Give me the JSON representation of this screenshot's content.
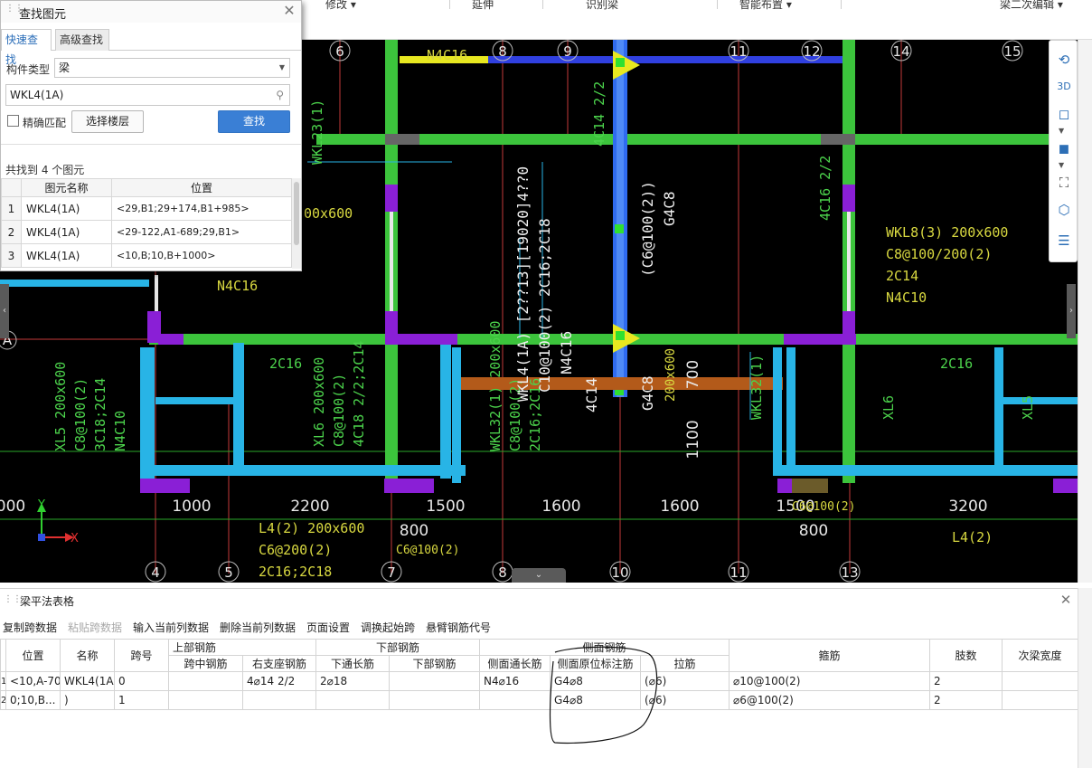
{
  "ribbon": {
    "items": [
      {
        "label": "修改",
        "has_caret": true
      },
      {
        "label": "延伸",
        "has_caret": false
      },
      {
        "label": "识别梁",
        "has_caret": false
      },
      {
        "label": "智能布置",
        "has_caret": true
      },
      {
        "label": "梁二次编辑",
        "has_caret": true
      }
    ]
  },
  "find_dialog": {
    "title": "查找图元",
    "tabs": [
      "快速查找",
      "高级查找"
    ],
    "type_label": "构件类型",
    "type_value": "梁",
    "search_value": "WKL4(1A)",
    "exact_match_label": "精确匹配",
    "select_floor_button": "选择楼层",
    "find_button": "查找",
    "result_count": "共找到 4 个图元",
    "columns": [
      "图元名称",
      "位置"
    ],
    "rows": [
      {
        "index": "1",
        "name": "WKL4(1A)",
        "location": "<29,B1;29+174,B1+985>"
      },
      {
        "index": "2",
        "name": "WKL4(1A)",
        "location": "<29-122,A1-689;29,B1>"
      },
      {
        "index": "3",
        "name": "WKL4(1A)",
        "location": "<10,B;10,B+1000>"
      }
    ]
  },
  "cad": {
    "top_axis_labels": [
      {
        "text": "6"
      },
      {
        "text": "8"
      },
      {
        "text": "9"
      },
      {
        "text": "11"
      },
      {
        "text": "12"
      },
      {
        "text": "14"
      },
      {
        "text": "15"
      }
    ],
    "bottom_axis_labels": [
      {
        "text": "4"
      },
      {
        "text": "5"
      },
      {
        "text": "7"
      },
      {
        "text": "8"
      },
      {
        "text": "10"
      },
      {
        "text": "11"
      },
      {
        "text": "13"
      }
    ],
    "left_axis_label": "A",
    "dimensions": [
      "000",
      "1000",
      "2200",
      "1500",
      "1600",
      "1600",
      "1500",
      "3200",
      "800",
      "800",
      "700",
      "1100"
    ],
    "annotations": {
      "n4c16_top": "N4C16",
      "n4c16_left": "N4C16",
      "wkl23": "WKL23(1)",
      "size_600": "00x600",
      "wkl4_1": "WKL4(1A) [2??13][19020]4??0",
      "wkl4_2": "C10@100(2) 2C16;2C18",
      "wkl4_3": "N4C16",
      "c6_g4c8_1": "(C6@100(2))",
      "c6_g4c8_2": "G4C8",
      "side_4c14": "4C14 2/2",
      "side_4c16": "4C16 2/2",
      "wkl8_1": "WKL8(3) 200x600",
      "wkl8_2": "C8@100/200(2)",
      "wkl8_3": "2C14",
      "wkl8_4": "N4C10",
      "mid_2c16_a": "2C16",
      "mid_2c16_b": "2C16",
      "xl5_1": "XL5 200x600",
      "xl5_2": "C8@100(2)",
      "xl5_3": "3C18;2C14",
      "xl5_4": "N4C10",
      "xl6_1": "XL6 200x600",
      "xl6_2": "C8@100(2)",
      "xl6_3": "4C18 2/2;2C14",
      "wkl32_1": "WKL32(1) 200x600",
      "wkl32_2": "C8@100(2)",
      "wkl32_3": "2C16;2C16",
      "wkl32r": "WKL32(1)",
      "xl6r": "XL6",
      "xl5r": "XL5",
      "c6_small": "C6@100(2)",
      "c6_small_r": "C6@100(2)",
      "l4_1": "L4(2) 200x600",
      "l4_2": "C6@200(2)",
      "l4_3": "2C16;2C18",
      "l4r": "L4(2)",
      "mid_4c14": "4C14",
      "mid_g4c8": "G4C8",
      "mid_200x600": "200x600",
      "mid_n4c16": "N4C16",
      "mid_2_2": "2/2"
    },
    "axis_x": "X",
    "axis_y": "Y"
  },
  "right_toolbar": {
    "icons": [
      "3d-rotate-icon",
      "3d-view-icon",
      "cube-outline-icon",
      "cube-solid-icon",
      "fullscreen-icon",
      "component-display-icon",
      "property-list-icon"
    ]
  },
  "panel": {
    "title": "梁平法表格",
    "toolbar": [
      {
        "label": "复制跨数据",
        "enabled": true
      },
      {
        "label": "粘贴跨数据",
        "enabled": false
      },
      {
        "label": "输入当前列数据",
        "enabled": true
      },
      {
        "label": "删除当前列数据",
        "enabled": true
      },
      {
        "label": "页面设置",
        "enabled": true
      },
      {
        "label": "调换起始跨",
        "enabled": true
      },
      {
        "label": "悬臂钢筋代号",
        "enabled": true
      }
    ],
    "group_headers": {
      "upper": "上部钢筋",
      "lower": "下部钢筋",
      "side": "侧面钢筋"
    },
    "columns": {
      "position": "位置",
      "name": "名称",
      "span": "跨号",
      "mid_span": "跨中钢筋",
      "right_support": "右支座钢筋",
      "lower_through": "下通长筋",
      "lower_rebar": "下部钢筋",
      "side_through": "侧面通长筋",
      "side_original": "侧面原位标注筋",
      "tie": "拉筋",
      "stirrup": "箍筋",
      "legs": "肢数",
      "secondary_width": "次梁宽度"
    },
    "rows": [
      {
        "row_no": "1",
        "position": "<10,A-70",
        "name": "WKL4(1A",
        "span": "0",
        "mid_span": "",
        "right_support": "4⌀14 2/2",
        "lower_through": "2⌀18",
        "lower_rebar": "",
        "side_through": "N4⌀16",
        "side_original": "G4⌀8",
        "tie": "(⌀6)",
        "stirrup": "⌀10@100(2)",
        "legs": "2",
        "secondary_width": ""
      },
      {
        "row_no": "2",
        "position": "0;10,B...",
        "name": ")",
        "span": "1",
        "mid_span": "",
        "right_support": "",
        "lower_through": "",
        "lower_rebar": "",
        "side_through": "",
        "side_original": "G4⌀8",
        "tie": "(⌀6)",
        "stirrup": "⌀6@100(2)",
        "legs": "2",
        "secondary_width": ""
      }
    ]
  },
  "colors": {
    "canvas_bg": "#000000",
    "beam_green": "#3cc43c",
    "beam_cyan": "#28b4e6",
    "beam_blue": "#2f6bf0",
    "support_purple": "#8a1fd6",
    "beam_yellow": "#e8e820",
    "beam_orange": "#b35a1a",
    "text_yellow": "#d8d840",
    "text_green": "#4cd34c",
    "text_cyan": "#28b4e6",
    "primary_button": "#3a7fd5",
    "tab_active_text": "#2a6db8"
  }
}
